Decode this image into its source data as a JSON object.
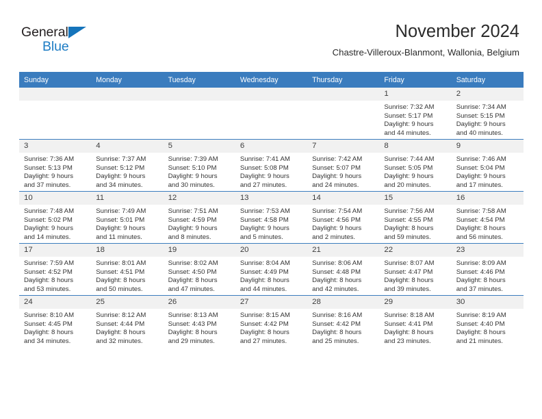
{
  "brand": {
    "name_part1": "General",
    "name_part2": "Blue",
    "accent_color": "#1d7cc4",
    "triangle_color": "#1574bb"
  },
  "header": {
    "title": "November 2024",
    "subtitle": "Chastre-Villeroux-Blanmont, Wallonia, Belgium"
  },
  "calendar": {
    "header_bg": "#3a7cbe",
    "daynum_bg": "#f1f1f1",
    "weekdays": [
      "Sunday",
      "Monday",
      "Tuesday",
      "Wednesday",
      "Thursday",
      "Friday",
      "Saturday"
    ],
    "weeks": [
      [
        {
          "day": "",
          "lines": []
        },
        {
          "day": "",
          "lines": []
        },
        {
          "day": "",
          "lines": []
        },
        {
          "day": "",
          "lines": []
        },
        {
          "day": "",
          "lines": []
        },
        {
          "day": "1",
          "lines": [
            "Sunrise: 7:32 AM",
            "Sunset: 5:17 PM",
            "Daylight: 9 hours",
            "and 44 minutes."
          ]
        },
        {
          "day": "2",
          "lines": [
            "Sunrise: 7:34 AM",
            "Sunset: 5:15 PM",
            "Daylight: 9 hours",
            "and 40 minutes."
          ]
        }
      ],
      [
        {
          "day": "3",
          "lines": [
            "Sunrise: 7:36 AM",
            "Sunset: 5:13 PM",
            "Daylight: 9 hours",
            "and 37 minutes."
          ]
        },
        {
          "day": "4",
          "lines": [
            "Sunrise: 7:37 AM",
            "Sunset: 5:12 PM",
            "Daylight: 9 hours",
            "and 34 minutes."
          ]
        },
        {
          "day": "5",
          "lines": [
            "Sunrise: 7:39 AM",
            "Sunset: 5:10 PM",
            "Daylight: 9 hours",
            "and 30 minutes."
          ]
        },
        {
          "day": "6",
          "lines": [
            "Sunrise: 7:41 AM",
            "Sunset: 5:08 PM",
            "Daylight: 9 hours",
            "and 27 minutes."
          ]
        },
        {
          "day": "7",
          "lines": [
            "Sunrise: 7:42 AM",
            "Sunset: 5:07 PM",
            "Daylight: 9 hours",
            "and 24 minutes."
          ]
        },
        {
          "day": "8",
          "lines": [
            "Sunrise: 7:44 AM",
            "Sunset: 5:05 PM",
            "Daylight: 9 hours",
            "and 20 minutes."
          ]
        },
        {
          "day": "9",
          "lines": [
            "Sunrise: 7:46 AM",
            "Sunset: 5:04 PM",
            "Daylight: 9 hours",
            "and 17 minutes."
          ]
        }
      ],
      [
        {
          "day": "10",
          "lines": [
            "Sunrise: 7:48 AM",
            "Sunset: 5:02 PM",
            "Daylight: 9 hours",
            "and 14 minutes."
          ]
        },
        {
          "day": "11",
          "lines": [
            "Sunrise: 7:49 AM",
            "Sunset: 5:01 PM",
            "Daylight: 9 hours",
            "and 11 minutes."
          ]
        },
        {
          "day": "12",
          "lines": [
            "Sunrise: 7:51 AM",
            "Sunset: 4:59 PM",
            "Daylight: 9 hours",
            "and 8 minutes."
          ]
        },
        {
          "day": "13",
          "lines": [
            "Sunrise: 7:53 AM",
            "Sunset: 4:58 PM",
            "Daylight: 9 hours",
            "and 5 minutes."
          ]
        },
        {
          "day": "14",
          "lines": [
            "Sunrise: 7:54 AM",
            "Sunset: 4:56 PM",
            "Daylight: 9 hours",
            "and 2 minutes."
          ]
        },
        {
          "day": "15",
          "lines": [
            "Sunrise: 7:56 AM",
            "Sunset: 4:55 PM",
            "Daylight: 8 hours",
            "and 59 minutes."
          ]
        },
        {
          "day": "16",
          "lines": [
            "Sunrise: 7:58 AM",
            "Sunset: 4:54 PM",
            "Daylight: 8 hours",
            "and 56 minutes."
          ]
        }
      ],
      [
        {
          "day": "17",
          "lines": [
            "Sunrise: 7:59 AM",
            "Sunset: 4:52 PM",
            "Daylight: 8 hours",
            "and 53 minutes."
          ]
        },
        {
          "day": "18",
          "lines": [
            "Sunrise: 8:01 AM",
            "Sunset: 4:51 PM",
            "Daylight: 8 hours",
            "and 50 minutes."
          ]
        },
        {
          "day": "19",
          "lines": [
            "Sunrise: 8:02 AM",
            "Sunset: 4:50 PM",
            "Daylight: 8 hours",
            "and 47 minutes."
          ]
        },
        {
          "day": "20",
          "lines": [
            "Sunrise: 8:04 AM",
            "Sunset: 4:49 PM",
            "Daylight: 8 hours",
            "and 44 minutes."
          ]
        },
        {
          "day": "21",
          "lines": [
            "Sunrise: 8:06 AM",
            "Sunset: 4:48 PM",
            "Daylight: 8 hours",
            "and 42 minutes."
          ]
        },
        {
          "day": "22",
          "lines": [
            "Sunrise: 8:07 AM",
            "Sunset: 4:47 PM",
            "Daylight: 8 hours",
            "and 39 minutes."
          ]
        },
        {
          "day": "23",
          "lines": [
            "Sunrise: 8:09 AM",
            "Sunset: 4:46 PM",
            "Daylight: 8 hours",
            "and 37 minutes."
          ]
        }
      ],
      [
        {
          "day": "24",
          "lines": [
            "Sunrise: 8:10 AM",
            "Sunset: 4:45 PM",
            "Daylight: 8 hours",
            "and 34 minutes."
          ]
        },
        {
          "day": "25",
          "lines": [
            "Sunrise: 8:12 AM",
            "Sunset: 4:44 PM",
            "Daylight: 8 hours",
            "and 32 minutes."
          ]
        },
        {
          "day": "26",
          "lines": [
            "Sunrise: 8:13 AM",
            "Sunset: 4:43 PM",
            "Daylight: 8 hours",
            "and 29 minutes."
          ]
        },
        {
          "day": "27",
          "lines": [
            "Sunrise: 8:15 AM",
            "Sunset: 4:42 PM",
            "Daylight: 8 hours",
            "and 27 minutes."
          ]
        },
        {
          "day": "28",
          "lines": [
            "Sunrise: 8:16 AM",
            "Sunset: 4:42 PM",
            "Daylight: 8 hours",
            "and 25 minutes."
          ]
        },
        {
          "day": "29",
          "lines": [
            "Sunrise: 8:18 AM",
            "Sunset: 4:41 PM",
            "Daylight: 8 hours",
            "and 23 minutes."
          ]
        },
        {
          "day": "30",
          "lines": [
            "Sunrise: 8:19 AM",
            "Sunset: 4:40 PM",
            "Daylight: 8 hours",
            "and 21 minutes."
          ]
        }
      ]
    ]
  }
}
